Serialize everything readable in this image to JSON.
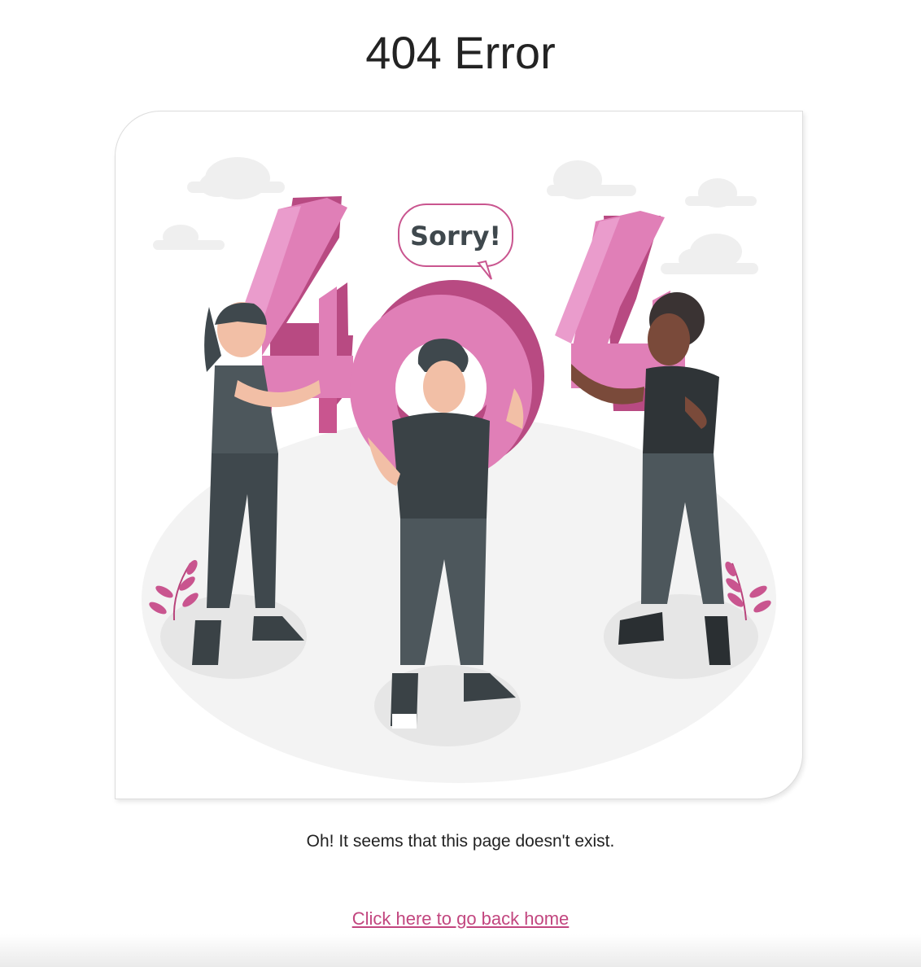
{
  "page": {
    "title": "404 Error",
    "message": "Oh! It seems that this page doesn't exist.",
    "home_link_label": "Click here to go back home"
  },
  "illustration": {
    "speech_bubble_text": "Sorry!",
    "digits": [
      "4",
      "0",
      "4"
    ]
  },
  "colors": {
    "accent_pink": "#e07fb7",
    "accent_pink_dark": "#b84a82",
    "link": "#c2467f",
    "clothing_dark": "#3f484d",
    "ground": "#f2f2f2"
  }
}
